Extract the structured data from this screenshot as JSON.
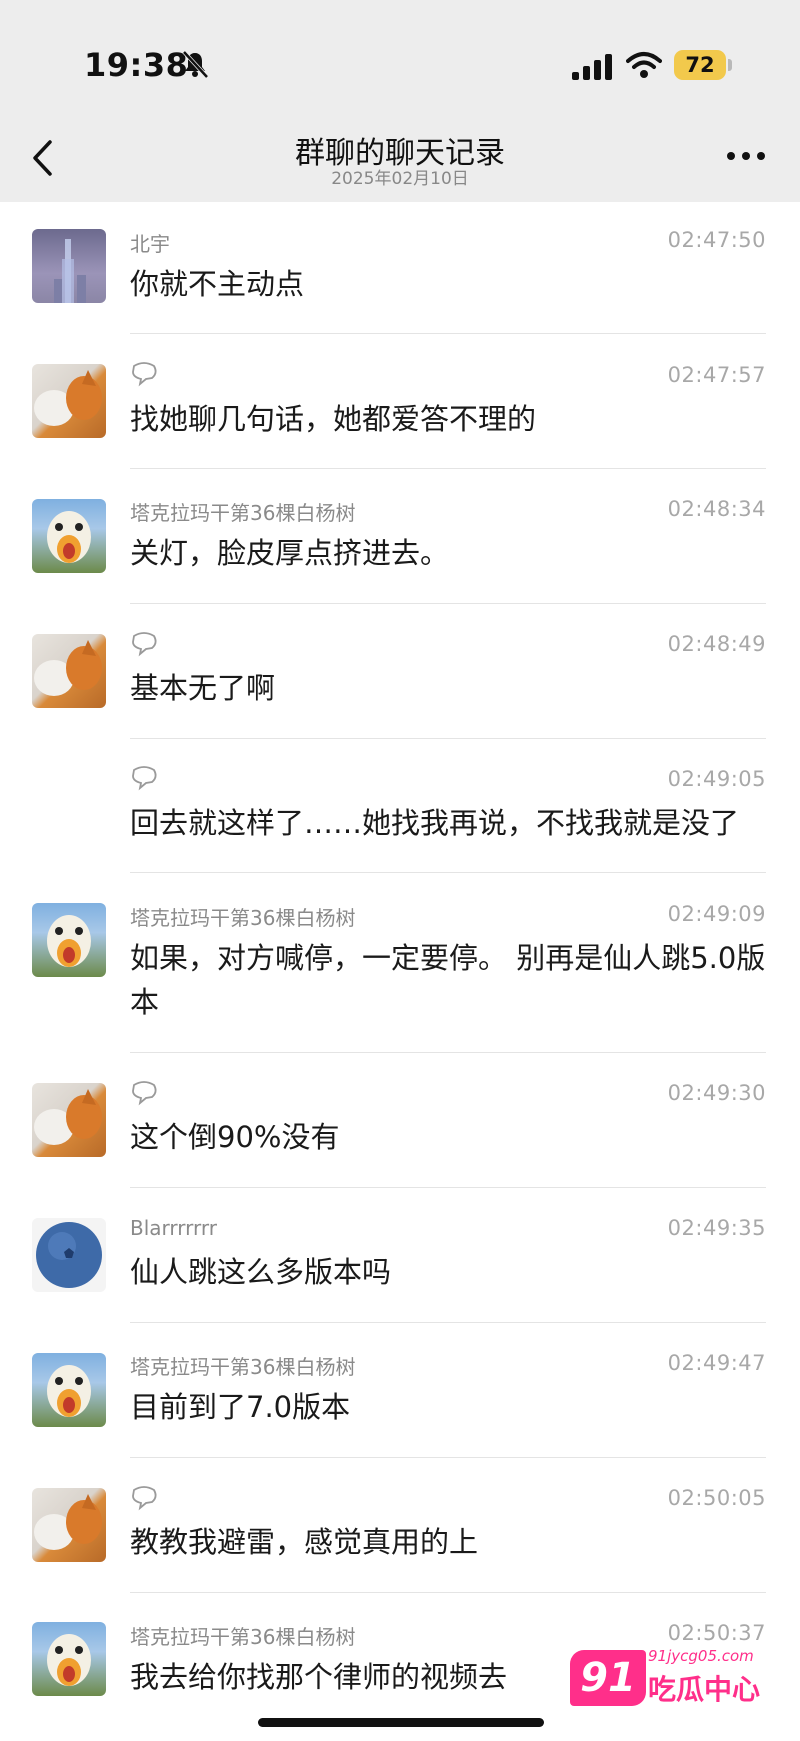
{
  "status_bar": {
    "time": "19:38",
    "battery": "72"
  },
  "header": {
    "title": "群聊的聊天记录",
    "date": "2025年02月10日"
  },
  "messages": [
    {
      "sender": "北宇",
      "time": "02:47:50",
      "text": "你就不主动点",
      "avatar": "city-night"
    },
    {
      "sender": "",
      "time": "02:47:57",
      "text": "找她聊几句话，她都爱答不理的",
      "avatar": "dog-cat"
    },
    {
      "sender": "塔克拉玛干第36棵白杨树",
      "time": "02:48:34",
      "text": "关灯，脸皮厚点挤进去。",
      "avatar": "duck"
    },
    {
      "sender": "",
      "time": "02:48:49",
      "text": "基本无了啊",
      "avatar": "dog-cat"
    },
    {
      "sender": "",
      "time": "02:49:05",
      "text": "回去就这样了……她找我再说，不找我就是没了",
      "avatar": ""
    },
    {
      "sender": "塔克拉玛干第36棵白杨树",
      "time": "02:49:09",
      "text": "如果，对方喊停，一定要停。 别再是仙人跳5.0版本",
      "avatar": "duck"
    },
    {
      "sender": "",
      "time": "02:49:30",
      "text": "这个倒90%没有",
      "avatar": "dog-cat"
    },
    {
      "sender": "Blarrrrrrr",
      "time": "02:49:35",
      "text": "仙人跳这么多版本吗",
      "avatar": "blueberry"
    },
    {
      "sender": "塔克拉玛干第36棵白杨树",
      "time": "02:49:47",
      "text": "目前到了7.0版本",
      "avatar": "duck"
    },
    {
      "sender": "",
      "time": "02:50:05",
      "text": "教教我避雷，感觉真用的上",
      "avatar": "dog-cat"
    },
    {
      "sender": "塔克拉玛干第36棵白杨树",
      "time": "02:50:37",
      "text": "我去给你找那个律师的视频去",
      "avatar": "duck"
    }
  ],
  "watermark": {
    "badge": "91",
    "domain": "91jycg05.com",
    "label": "吃瓜中心"
  }
}
